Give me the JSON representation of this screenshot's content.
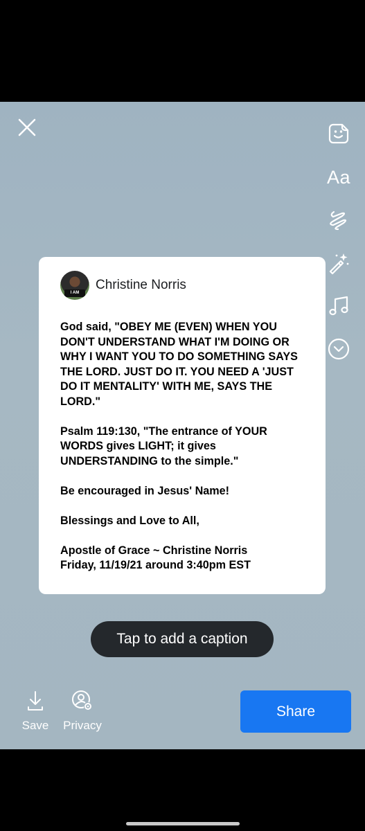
{
  "close": {
    "icon": "close-icon"
  },
  "tools": [
    {
      "name": "sticker-icon"
    },
    {
      "name": "text-icon",
      "label": "Aa"
    },
    {
      "name": "draw-icon"
    },
    {
      "name": "effects-icon"
    },
    {
      "name": "music-icon"
    },
    {
      "name": "more-icon"
    }
  ],
  "post": {
    "author": "Christine Norris",
    "avatar_badge": "I AM",
    "paragraphs": [
      "God said, \"OBEY ME (EVEN) WHEN YOU DON'T UNDERSTAND WHAT I'M DOING OR WHY I WANT YOU TO DO SOMETHING SAYS THE LORD. JUST DO IT. YOU NEED A 'JUST DO IT MENTALITY' WITH ME, SAYS THE LORD.\"",
      "Psalm 119:130, \"The entrance of YOUR WORDS gives LIGHT; it gives UNDERSTANDING to the simple.\"",
      "Be encouraged in Jesus' Name!",
      "Blessings and Love to All,",
      "Apostle of Grace ~ Christine Norris\nFriday, 11/19/21 around 3:40pm EST"
    ]
  },
  "caption": {
    "label": "Tap to add a caption"
  },
  "bottom": {
    "save_label": "Save",
    "privacy_label": "Privacy",
    "share_label": "Share"
  },
  "colors": {
    "accent": "#1877f2",
    "background": "#a4b6c1",
    "caption_bg": "#24282c"
  }
}
